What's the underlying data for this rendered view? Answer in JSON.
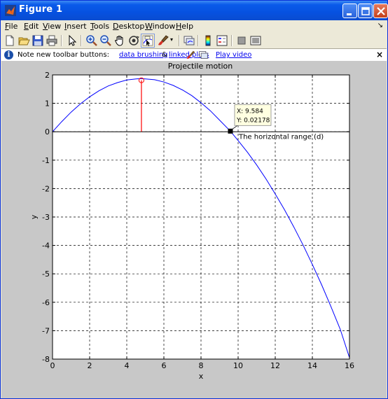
{
  "window": {
    "title": "Figure 1"
  },
  "menu": [
    "File",
    "Edit",
    "View",
    "Insert",
    "Tools",
    "Desktop",
    "Window",
    "Help"
  ],
  "menu_underline": [
    "F",
    "E",
    "V",
    "I",
    "T",
    "D",
    "W",
    "H"
  ],
  "toolbar_icons": [
    "new-figure-icon",
    "open-file-icon",
    "save-icon",
    "print-icon",
    "edit-plot-icon",
    "zoom-in-icon",
    "zoom-out-icon",
    "pan-icon",
    "rotate-3d-icon",
    "data-cursor-icon",
    "brush-icon",
    "link-plot-icon",
    "colorbar-icon",
    "legend-icon",
    "hide-plot-tools-icon",
    "show-plot-tools-icon"
  ],
  "infobar": {
    "text": "Note new toolbar buttons:",
    "link1": "data brushing",
    "amp": "&",
    "link2": "linked plots",
    "video": "Play video",
    "close": "×"
  },
  "chart_data": {
    "type": "line",
    "title": "Projectile motion",
    "xlabel": "x",
    "ylabel": "y",
    "xlim": [
      0,
      16
    ],
    "ylim": [
      -8,
      2
    ],
    "xticks": [
      0,
      2,
      4,
      6,
      8,
      10,
      12,
      14,
      16
    ],
    "yticks": [
      2,
      1,
      0,
      -1,
      -2,
      -3,
      -4,
      -5,
      -6,
      -7,
      -8
    ],
    "grid": true,
    "series": [
      {
        "color": "#0000FF",
        "x": [
          0,
          0.5,
          1,
          1.5,
          2,
          2.5,
          3,
          3.5,
          4,
          4.5,
          4.79,
          5,
          5.5,
          6,
          6.5,
          7,
          7.5,
          8,
          8.5,
          9,
          9.584,
          10,
          10.5,
          11,
          11.5,
          12,
          12.5,
          13,
          13.5,
          14,
          14.5,
          15,
          15.5,
          16
        ],
        "y": [
          0,
          0.36,
          0.69,
          0.98,
          1.23,
          1.44,
          1.61,
          1.73,
          1.82,
          1.86,
          1.87,
          1.86,
          1.83,
          1.75,
          1.63,
          1.47,
          1.27,
          1.02,
          0.74,
          0.41,
          0.02,
          -0.31,
          -0.72,
          -1.17,
          -1.66,
          -2.19,
          -2.75,
          -3.35,
          -3.99,
          -4.67,
          -5.39,
          -6.15,
          -6.95,
          -7.95
        ]
      }
    ],
    "max_marker": {
      "x": 4.79,
      "y": 1.81,
      "color": "#FF0000"
    },
    "datatip": {
      "x": 9.584,
      "y": 0.02178,
      "label_x": "X: 9.584",
      "label_y": "Y: 0.02178"
    },
    "annotation": "The horizontal range (d)",
    "zero_line": 0
  }
}
